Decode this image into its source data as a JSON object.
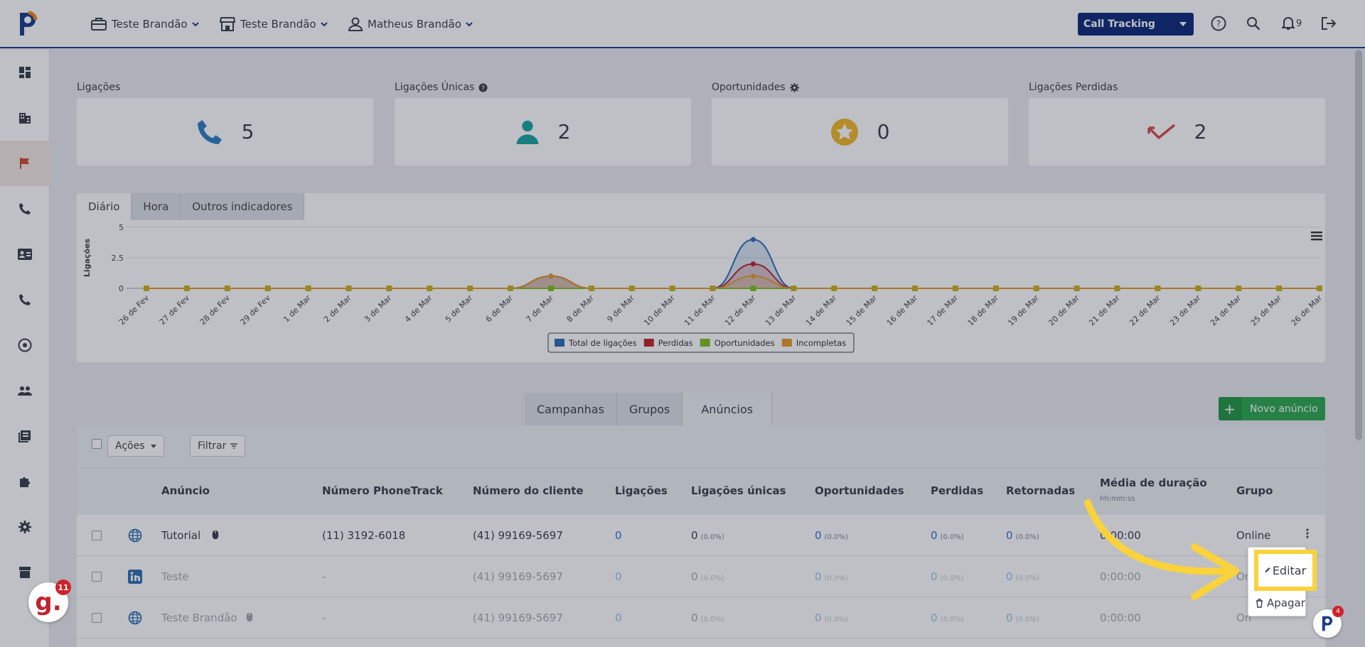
{
  "header": {
    "nav": [
      {
        "label": "Teste Brandão"
      },
      {
        "label": "Teste Brandão"
      },
      {
        "label": "Matheus Brandão"
      }
    ],
    "product_select": "Call Tracking",
    "notifications_count": "9"
  },
  "stats": [
    {
      "label": "Ligações",
      "value": "5"
    },
    {
      "label": "Ligações Únicas",
      "value": "2"
    },
    {
      "label": "Oportunidades",
      "value": "0"
    },
    {
      "label": "Ligações Perdidas",
      "value": "2"
    }
  ],
  "chart_tabs": [
    "Diário",
    "Hora",
    "Outros indicadores"
  ],
  "chart_data": {
    "type": "area",
    "ylabel": "Ligações",
    "ylim": [
      0,
      5
    ],
    "yticks": [
      "0",
      "2.5",
      "5"
    ],
    "categories": [
      "26 de Fev",
      "27 de Fev",
      "28 de Fev",
      "29 de Fev",
      "1 de Mar",
      "2 de Mar",
      "3 de Mar",
      "4 de Mar",
      "5 de Mar",
      "6 de Mar",
      "7 de Mar",
      "8 de Mar",
      "9 de Mar",
      "10 de Mar",
      "11 de Mar",
      "12 de Mar",
      "13 de Mar",
      "14 de Mar",
      "15 de Mar",
      "16 de Mar",
      "17 de Mar",
      "18 de Mar",
      "19 de Mar",
      "20 de Mar",
      "21 de Mar",
      "22 de Mar",
      "23 de Mar",
      "24 de Mar",
      "25 de Mar",
      "26 de Mar"
    ],
    "series": [
      {
        "name": "Total de ligações",
        "color": "#2f6cb8",
        "values": [
          0,
          0,
          0,
          0,
          0,
          0,
          0,
          0,
          0,
          0,
          1,
          0,
          0,
          0,
          0,
          4,
          0,
          0,
          0,
          0,
          0,
          0,
          0,
          0,
          0,
          0,
          0,
          0,
          0,
          0
        ]
      },
      {
        "name": "Perdidas",
        "color": "#c0242b",
        "values": [
          0,
          0,
          0,
          0,
          0,
          0,
          0,
          0,
          0,
          0,
          1,
          0,
          0,
          0,
          0,
          2,
          0,
          0,
          0,
          0,
          0,
          0,
          0,
          0,
          0,
          0,
          0,
          0,
          0,
          0
        ]
      },
      {
        "name": "Oportunidades",
        "color": "#7fbf1f",
        "values": [
          0,
          0,
          0,
          0,
          0,
          0,
          0,
          0,
          0,
          0,
          0,
          0,
          0,
          0,
          0,
          0,
          0,
          0,
          0,
          0,
          0,
          0,
          0,
          0,
          0,
          0,
          0,
          0,
          0,
          0
        ]
      },
      {
        "name": "Incompletas",
        "color": "#e59a2c",
        "values": [
          0,
          0,
          0,
          0,
          0,
          0,
          0,
          0,
          0,
          0,
          1,
          0,
          0,
          0,
          0,
          1,
          0,
          0,
          0,
          0,
          0,
          0,
          0,
          0,
          0,
          0,
          0,
          0,
          0,
          0
        ]
      }
    ],
    "legend": "bottom-center"
  },
  "table_tabs": [
    "Campanhas",
    "Grupos",
    "Anúncios"
  ],
  "new_button": "Novo anúncio",
  "toolbar": {
    "actions": "Ações",
    "filter": "Filtrar"
  },
  "columns": [
    "Anúncio",
    "Número PhoneTrack",
    "Número do cliente",
    "Ligações",
    "Ligações únicas",
    "Oportunidades",
    "Perdidas",
    "Retornadas",
    "Média de duração",
    "Grupo"
  ],
  "duration_sub": "hh:mm:ss",
  "rows": [
    {
      "name": "Tutorial",
      "phonetrack": "(11) 3192-6018",
      "client": "(41) 99169-5697",
      "calls": "0",
      "unique": "0",
      "unique_pct": "(0.0%)",
      "opps": "0",
      "opps_pct": "(0.0%)",
      "lost": "0",
      "lost_pct": "(0.0%)",
      "returned": "0",
      "returned_pct": "(0.0%)",
      "duration": "0:00:00",
      "group": "Online"
    },
    {
      "name": "Teste",
      "phonetrack": "-",
      "client": "(41) 99169-5697",
      "calls": "0",
      "unique": "0",
      "unique_pct": "(0.0%)",
      "opps": "0",
      "opps_pct": "(0.0%)",
      "lost": "0",
      "lost_pct": "(0.0%)",
      "returned": "0",
      "returned_pct": "(0.0%)",
      "duration": "0:00:00",
      "group": "On"
    },
    {
      "name": "Teste Brandão",
      "phonetrack": "-",
      "client": "(41) 99169-5697",
      "calls": "0",
      "unique": "0",
      "unique_pct": "(0.0%)",
      "opps": "0",
      "opps_pct": "(0.0%)",
      "lost": "0",
      "lost_pct": "(0.0%)",
      "returned": "0",
      "returned_pct": "(0.0%)",
      "duration": "0:00:00",
      "group": "On"
    }
  ],
  "context_menu": {
    "edit": "Editar",
    "delete": "Apagar"
  },
  "badges": {
    "g_letter": "g.",
    "g_count": "11",
    "p_count": "4"
  },
  "colors": {
    "brand_blue": "#0f2a79",
    "accent_yellow": "#f9d23c",
    "success_green": "#2da84f"
  }
}
